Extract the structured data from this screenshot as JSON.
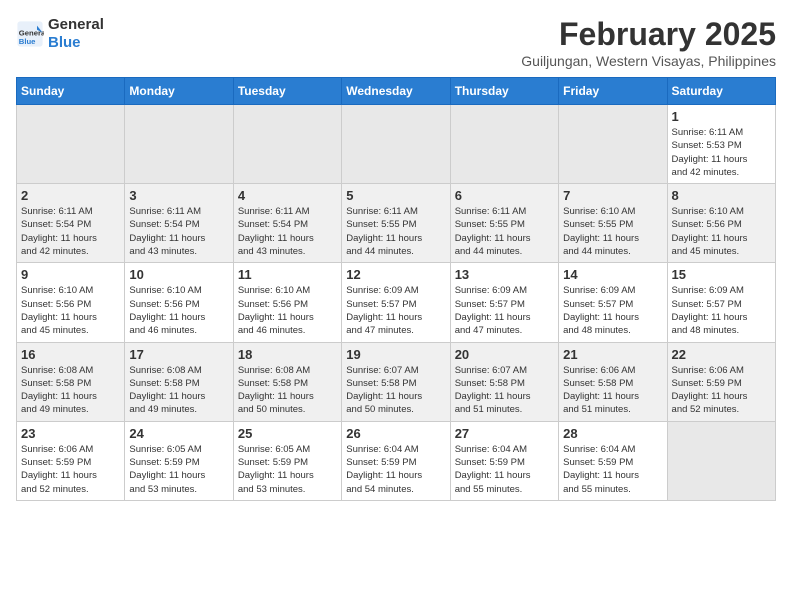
{
  "header": {
    "logo_line1": "General",
    "logo_line2": "Blue",
    "month_year": "February 2025",
    "location": "Guiljungan, Western Visayas, Philippines"
  },
  "weekdays": [
    "Sunday",
    "Monday",
    "Tuesday",
    "Wednesday",
    "Thursday",
    "Friday",
    "Saturday"
  ],
  "weeks": [
    [
      {
        "day": "",
        "info": ""
      },
      {
        "day": "",
        "info": ""
      },
      {
        "day": "",
        "info": ""
      },
      {
        "day": "",
        "info": ""
      },
      {
        "day": "",
        "info": ""
      },
      {
        "day": "",
        "info": ""
      },
      {
        "day": "1",
        "info": "Sunrise: 6:11 AM\nSunset: 5:53 PM\nDaylight: 11 hours\nand 42 minutes."
      }
    ],
    [
      {
        "day": "2",
        "info": "Sunrise: 6:11 AM\nSunset: 5:54 PM\nDaylight: 11 hours\nand 42 minutes."
      },
      {
        "day": "3",
        "info": "Sunrise: 6:11 AM\nSunset: 5:54 PM\nDaylight: 11 hours\nand 43 minutes."
      },
      {
        "day": "4",
        "info": "Sunrise: 6:11 AM\nSunset: 5:54 PM\nDaylight: 11 hours\nand 43 minutes."
      },
      {
        "day": "5",
        "info": "Sunrise: 6:11 AM\nSunset: 5:55 PM\nDaylight: 11 hours\nand 44 minutes."
      },
      {
        "day": "6",
        "info": "Sunrise: 6:11 AM\nSunset: 5:55 PM\nDaylight: 11 hours\nand 44 minutes."
      },
      {
        "day": "7",
        "info": "Sunrise: 6:10 AM\nSunset: 5:55 PM\nDaylight: 11 hours\nand 44 minutes."
      },
      {
        "day": "8",
        "info": "Sunrise: 6:10 AM\nSunset: 5:56 PM\nDaylight: 11 hours\nand 45 minutes."
      }
    ],
    [
      {
        "day": "9",
        "info": "Sunrise: 6:10 AM\nSunset: 5:56 PM\nDaylight: 11 hours\nand 45 minutes."
      },
      {
        "day": "10",
        "info": "Sunrise: 6:10 AM\nSunset: 5:56 PM\nDaylight: 11 hours\nand 46 minutes."
      },
      {
        "day": "11",
        "info": "Sunrise: 6:10 AM\nSunset: 5:56 PM\nDaylight: 11 hours\nand 46 minutes."
      },
      {
        "day": "12",
        "info": "Sunrise: 6:09 AM\nSunset: 5:57 PM\nDaylight: 11 hours\nand 47 minutes."
      },
      {
        "day": "13",
        "info": "Sunrise: 6:09 AM\nSunset: 5:57 PM\nDaylight: 11 hours\nand 47 minutes."
      },
      {
        "day": "14",
        "info": "Sunrise: 6:09 AM\nSunset: 5:57 PM\nDaylight: 11 hours\nand 48 minutes."
      },
      {
        "day": "15",
        "info": "Sunrise: 6:09 AM\nSunset: 5:57 PM\nDaylight: 11 hours\nand 48 minutes."
      }
    ],
    [
      {
        "day": "16",
        "info": "Sunrise: 6:08 AM\nSunset: 5:58 PM\nDaylight: 11 hours\nand 49 minutes."
      },
      {
        "day": "17",
        "info": "Sunrise: 6:08 AM\nSunset: 5:58 PM\nDaylight: 11 hours\nand 49 minutes."
      },
      {
        "day": "18",
        "info": "Sunrise: 6:08 AM\nSunset: 5:58 PM\nDaylight: 11 hours\nand 50 minutes."
      },
      {
        "day": "19",
        "info": "Sunrise: 6:07 AM\nSunset: 5:58 PM\nDaylight: 11 hours\nand 50 minutes."
      },
      {
        "day": "20",
        "info": "Sunrise: 6:07 AM\nSunset: 5:58 PM\nDaylight: 11 hours\nand 51 minutes."
      },
      {
        "day": "21",
        "info": "Sunrise: 6:06 AM\nSunset: 5:58 PM\nDaylight: 11 hours\nand 51 minutes."
      },
      {
        "day": "22",
        "info": "Sunrise: 6:06 AM\nSunset: 5:59 PM\nDaylight: 11 hours\nand 52 minutes."
      }
    ],
    [
      {
        "day": "23",
        "info": "Sunrise: 6:06 AM\nSunset: 5:59 PM\nDaylight: 11 hours\nand 52 minutes."
      },
      {
        "day": "24",
        "info": "Sunrise: 6:05 AM\nSunset: 5:59 PM\nDaylight: 11 hours\nand 53 minutes."
      },
      {
        "day": "25",
        "info": "Sunrise: 6:05 AM\nSunset: 5:59 PM\nDaylight: 11 hours\nand 53 minutes."
      },
      {
        "day": "26",
        "info": "Sunrise: 6:04 AM\nSunset: 5:59 PM\nDaylight: 11 hours\nand 54 minutes."
      },
      {
        "day": "27",
        "info": "Sunrise: 6:04 AM\nSunset: 5:59 PM\nDaylight: 11 hours\nand 55 minutes."
      },
      {
        "day": "28",
        "info": "Sunrise: 6:04 AM\nSunset: 5:59 PM\nDaylight: 11 hours\nand 55 minutes."
      },
      {
        "day": "",
        "info": ""
      }
    ]
  ]
}
